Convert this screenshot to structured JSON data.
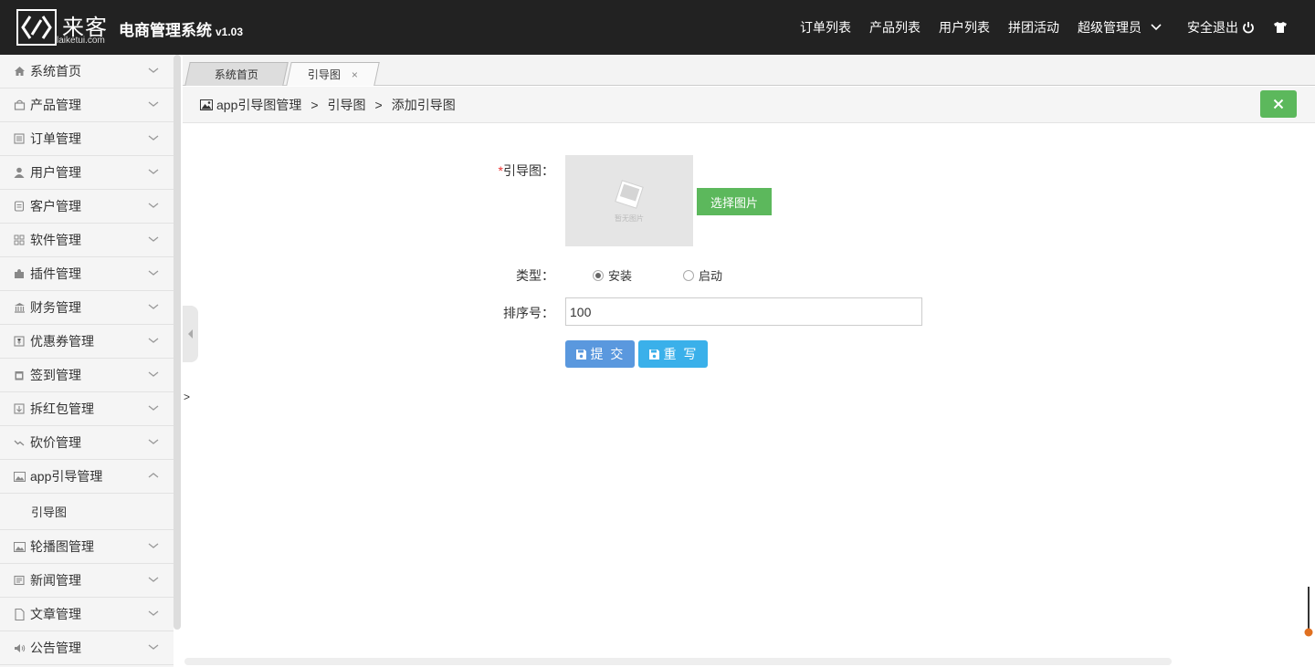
{
  "header": {
    "brand_cn": "来客",
    "brand_en": "laiketui.com",
    "app_title": "电商管理系统",
    "app_version": "v1.03",
    "nav": [
      "订单列表",
      "产品列表",
      "用户列表",
      "拼团活动"
    ],
    "admin_label": "超级管理员",
    "logout_label": "安全退出",
    "icons": [
      "chevron-down-icon",
      "power-icon",
      "tshirt-icon"
    ]
  },
  "sidebar": {
    "items": [
      {
        "label": "系统首页",
        "icon": "home-icon"
      },
      {
        "label": "产品管理",
        "icon": "bag-icon"
      },
      {
        "label": "订单管理",
        "icon": "list-icon"
      },
      {
        "label": "用户管理",
        "icon": "user-icon"
      },
      {
        "label": "客户管理",
        "icon": "client-icon"
      },
      {
        "label": "软件管理",
        "icon": "grid-icon"
      },
      {
        "label": "插件管理",
        "icon": "puzzle-icon"
      },
      {
        "label": "财务管理",
        "icon": "bank-icon"
      },
      {
        "label": "优惠券管理",
        "icon": "coupon-icon"
      },
      {
        "label": "签到管理",
        "icon": "calendar-icon"
      },
      {
        "label": "拆红包管理",
        "icon": "redpacket-icon"
      },
      {
        "label": "砍价管理",
        "icon": "trend-icon"
      },
      {
        "label": "app引导管理",
        "icon": "image-icon",
        "expanded": true
      },
      {
        "label": "轮播图管理",
        "icon": "picture-icon"
      },
      {
        "label": "新闻管理",
        "icon": "news-icon"
      },
      {
        "label": "文章管理",
        "icon": "file-icon"
      },
      {
        "label": "公告管理",
        "icon": "speaker-icon"
      }
    ],
    "sub_item": "引导图"
  },
  "tabs": [
    {
      "label": "系统首页",
      "active": false
    },
    {
      "label": "引导图",
      "active": true,
      "close": "×"
    }
  ],
  "breadcrumb": {
    "root": "app引导图管理",
    "mid": "引导图",
    "current": "添加引导图",
    "sep": ">"
  },
  "form": {
    "required_mark": "*",
    "image_label": "引导图：",
    "image_placeholder": "暂无图片",
    "choose_btn": "选择图片",
    "type_label": "类型：",
    "type_options": [
      "安装",
      "启动"
    ],
    "type_selected": "安装",
    "sort_label": "排序号：",
    "sort_value": "100",
    "submit_btn": "提 交",
    "reset_btn": "重 写"
  },
  "stray_char": ">",
  "colors": {
    "header_bg": "#222222",
    "green": "#5cb85c",
    "submit_blue": "#5a98de",
    "reset_blue": "#3ab0ea",
    "sidebar_bg": "#f5f5f5"
  }
}
